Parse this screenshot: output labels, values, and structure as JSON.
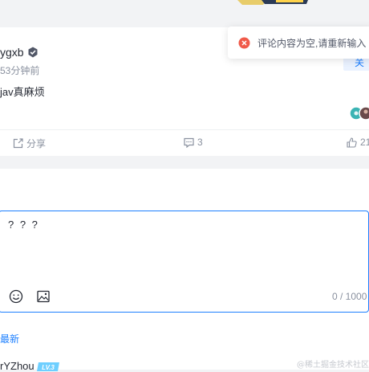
{
  "post": {
    "username": "ygxb",
    "time": "53分钟前",
    "content": "jav真麻烦",
    "follow_label": "关"
  },
  "actions": {
    "share_label": "分享",
    "comment_count": "3",
    "like_count": "21"
  },
  "editor": {
    "text": "? ? ?",
    "counter": "0 / 1000"
  },
  "tabs": {
    "latest": "最新"
  },
  "next_comment": {
    "username": "rYZhou",
    "level": "LV.3"
  },
  "watermark": "@稀土掘金技术社区",
  "toast": {
    "message": "评论内容为空,请重新输入"
  },
  "colors": {
    "accent": "#1e80ff",
    "error": "#f05a4a"
  }
}
